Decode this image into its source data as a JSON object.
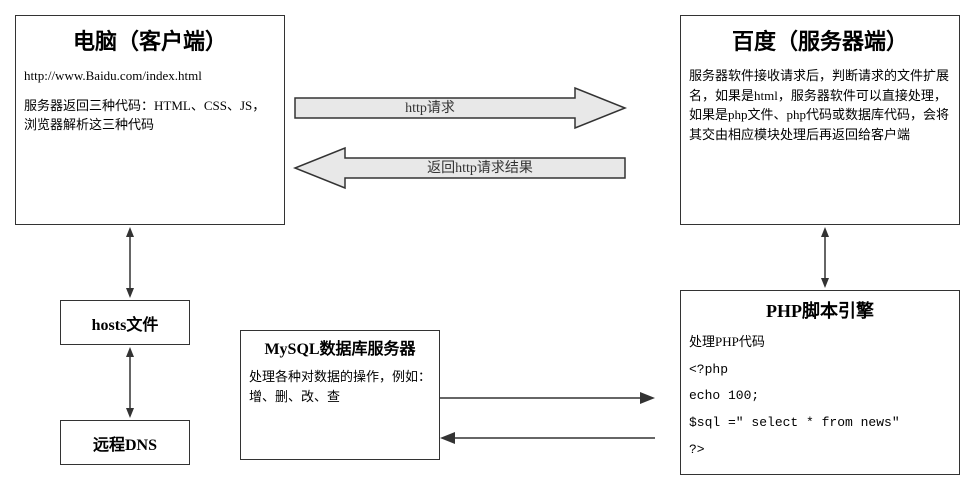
{
  "client": {
    "title": "电脑（客户端）",
    "url": "http://www.Baidu.com/index.html",
    "desc": "服务器返回三种代码：HTML、CSS、JS，浏览器解析这三种代码"
  },
  "server": {
    "title": "百度（服务器端）",
    "desc": "服务器软件接收请求后，判断请求的文件扩展名，如果是html，服务器软件可以直接处理，如果是php文件、php代码或数据库代码，会将其交由相应模块处理后再返回给客户端"
  },
  "hosts": {
    "title": "hosts文件"
  },
  "dns": {
    "title": "远程DNS"
  },
  "mysql": {
    "title": "MySQL数据库服务器",
    "desc": "处理各种对数据的操作，例如：增、删、改、查"
  },
  "php": {
    "title": "PHP脚本引擎",
    "desc": "处理PHP代码",
    "code_line1": "<?php",
    "code_line2": "  echo 100;",
    "code_line3": "  $sql =\" select * from news\"",
    "code_line4": "?>"
  },
  "arrows": {
    "http_request": "http请求",
    "http_response": "返回http请求结果"
  }
}
